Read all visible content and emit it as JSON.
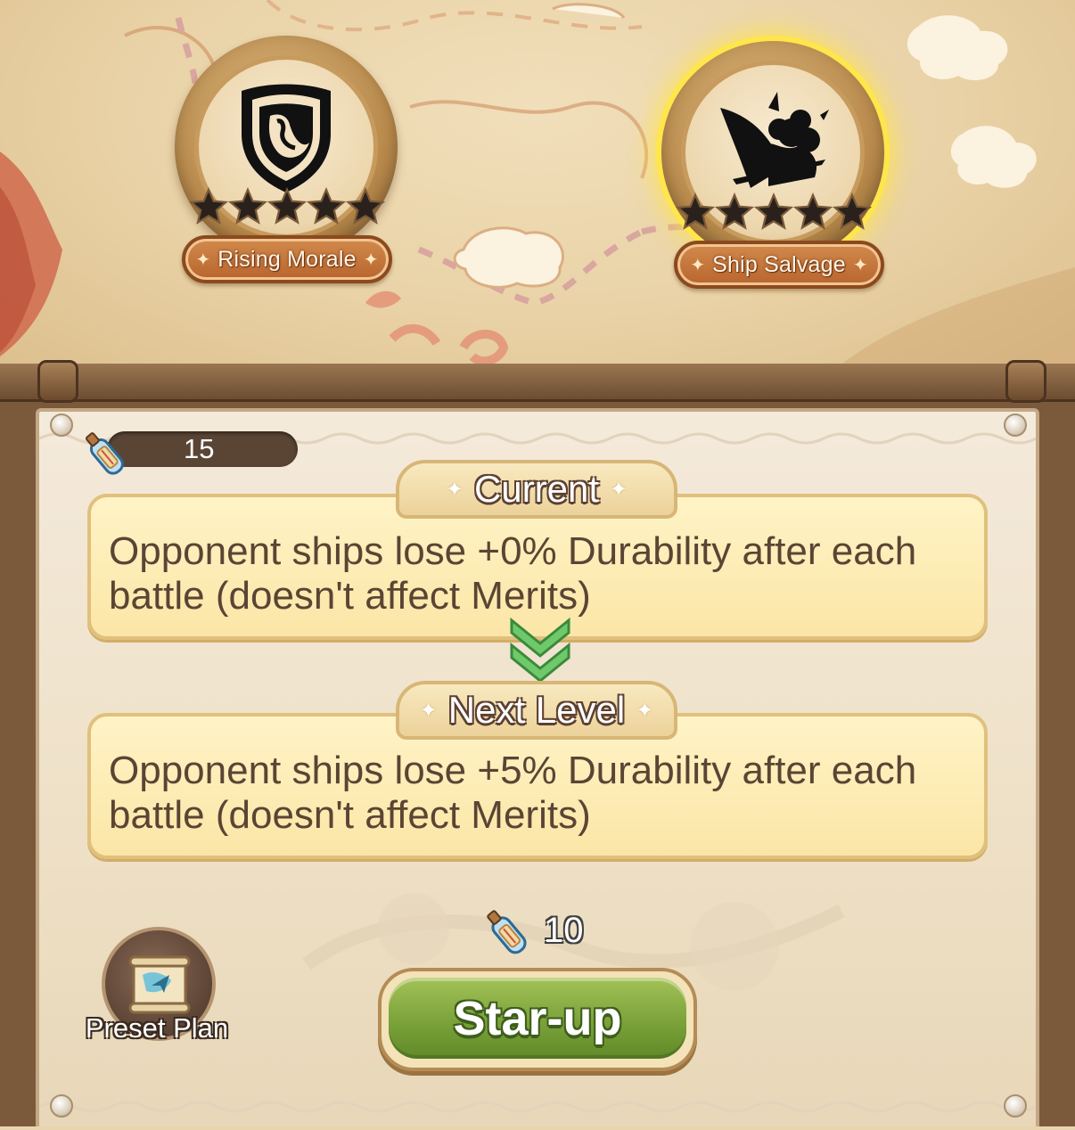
{
  "skills": [
    {
      "name": "Rising Morale",
      "icon": "shield-icon",
      "stars_filled": 0,
      "stars_total": 5,
      "selected": false
    },
    {
      "name": "Ship Salvage",
      "icon": "ship-salvage-icon",
      "stars_filled": 0,
      "stars_total": 5,
      "selected": true
    }
  ],
  "currency": {
    "icon": "message-bottle-icon",
    "amount": "15"
  },
  "current": {
    "title": "Current",
    "description": "Opponent ships lose +0% Durability after each battle (doesn't affect Merits)"
  },
  "next": {
    "title": "Next Level",
    "description": "Opponent ships lose +5% Durability after each battle (doesn't affect Merits)"
  },
  "cost": {
    "icon": "message-bottle-icon",
    "amount": "10"
  },
  "buttons": {
    "starup": "Star-up",
    "preset": "Preset Plan"
  },
  "colors": {
    "selected_glow": "#ffe64a",
    "button_green": "#7ba23a",
    "plaque": "#c2723a"
  }
}
